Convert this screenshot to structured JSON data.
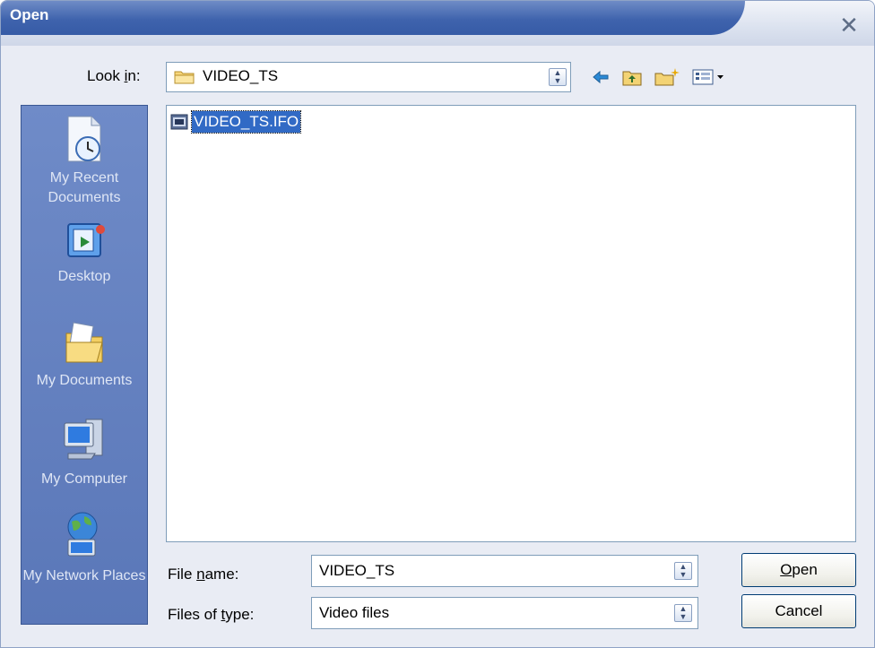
{
  "window": {
    "title": "Open"
  },
  "look_in": {
    "label": "Look in:",
    "value": "VIDEO_TS"
  },
  "places": [
    {
      "label": "My Recent Documents",
      "icon": "recent-documents-icon"
    },
    {
      "label": "Desktop",
      "icon": "desktop-icon"
    },
    {
      "label": "My Documents",
      "icon": "my-documents-icon"
    },
    {
      "label": "My Computer",
      "icon": "my-computer-icon"
    },
    {
      "label": "My Network Places",
      "icon": "network-places-icon"
    }
  ],
  "files": [
    {
      "name": "VIDEO_TS.IFO",
      "selected": true
    }
  ],
  "file_name": {
    "label": "File name:",
    "value": "VIDEO_TS"
  },
  "file_type": {
    "label": "Files of type:",
    "value": "Video files"
  },
  "buttons": {
    "open": "Open",
    "cancel": "Cancel"
  },
  "colors": {
    "title_bar": "#3f63ad",
    "places_bar": "#5a77b8",
    "selection": "#316ac5"
  }
}
